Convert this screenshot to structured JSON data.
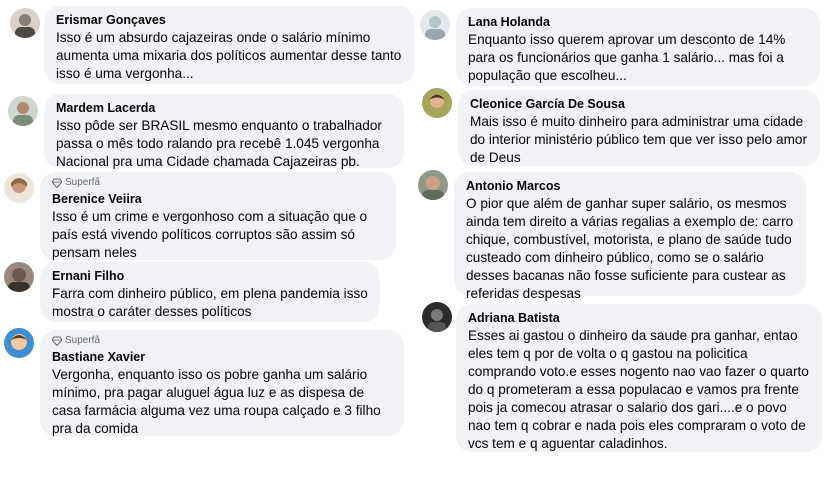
{
  "comments": [
    {
      "name": "Erismar Gonçaves",
      "text": "Isso é um absurdo cajazeiras onde o salário mínimo aumenta uma mixaria dos políticos aumentar desse tanto isso é uma vergonha...",
      "avatar_color": "#8a7f74"
    },
    {
      "name": "Mardem Lacerda",
      "text": "Isso pôde ser BRASIL mesmo enquanto o trabalhador passa o mês todo ralando pra recebê 1.045 vergonha Nacional pra uma Cidade chamada Cajazeiras pb.",
      "avatar_color": "#7e8a7a"
    },
    {
      "badge": "Superfã",
      "name": "Berenice Veiira",
      "text": "Isso é um crime e vergonhoso com a situação que o país está vivendo políticos corruptos são assim só pensam neles",
      "avatar_color": "#c79a7b"
    },
    {
      "name": "Ernani Filho",
      "text": "Farra com dinheiro público, em plena pandemia isso mostra o caráter desses políticos",
      "avatar_color": "#6e5a50"
    },
    {
      "badge": "Superfã",
      "name": "Bastiane Xavier",
      "text": "Vergonha, enquanto isso os pobre ganha um salário mínimo, pra pagar aluguel água luz e as dispesa de casa farmácia alguma vez uma roupa calçado e 3 filho pra da comida",
      "avatar_color": "#3d8fd1"
    },
    {
      "name": "Lana Holanda",
      "text": "Enquanto isso querem aprovar um desconto de 14% para os funcionários que ganha 1 salário... mas foi a população que escolheu...",
      "avatar_color": "#b9c4c9"
    },
    {
      "name": "Cleonice García De Sousa",
      "text": "Mais isso é muito dinheiro para administrar uma cidade do interior ministério público tem que ver isso pelo amor de Deus",
      "avatar_color": "#7d8a4a"
    },
    {
      "name": "Antonio Marcos",
      "text": "O pior que além de ganhar super salário, os mesmos ainda tem direito a várias regalias a exemplo de: carro chique, combustível, motorista, e plano de saúde tudo custeado com dinheiro público, como se o salário desses bacanas não fosse suficiente para custear as referidas despesas",
      "avatar_color": "#5f6b5a"
    },
    {
      "name": "Adriana Batista",
      "text": "Esses ai gastou o dinheiro da saude pra ganhar, entao eles tem q por de volta o q gastou na policitica comprando voto.e esses nogento nao vao fazer o quarto do q prometeram a essa populacao e vamos pra frente pois ja comecou atrasar o salario dos gari....e o povo nao tem q cobrar e nada pois eles compraram o voto de vcs tem e q aguentar caladinhos.",
      "avatar_color": "#2b2b2b"
    }
  ]
}
